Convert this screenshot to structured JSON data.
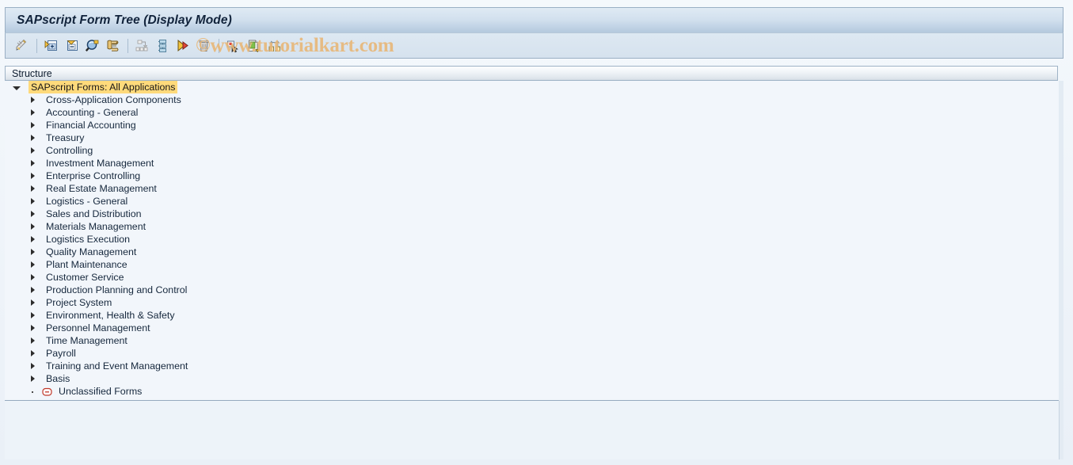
{
  "window": {
    "title": "SAPscript Form Tree (Display Mode)"
  },
  "watermark": {
    "text": "©www.tutorialkart.com",
    "color": "#e8b87a"
  },
  "toolbar": {
    "buttons": [
      {
        "name": "display-change-icon",
        "tooltip": "Display <-> Change"
      },
      {
        "name": "expand-node-icon",
        "tooltip": "Expand Node"
      },
      {
        "name": "collapse-node-icon",
        "tooltip": "Collapse Node"
      },
      {
        "name": "find-icon",
        "tooltip": "Find"
      },
      {
        "name": "scroll-list-icon",
        "tooltip": "Form Overview"
      },
      {
        "name": "sort-structure-icon",
        "tooltip": "Sort"
      },
      {
        "name": "hierarchy-icon",
        "tooltip": "Hierarchy"
      },
      {
        "name": "execute-icon",
        "tooltip": "Execute"
      },
      {
        "name": "delete-icon",
        "tooltip": "Delete"
      },
      {
        "name": "select-object-icon",
        "tooltip": "Select Object"
      },
      {
        "name": "copy-document-icon",
        "tooltip": "Copy"
      },
      {
        "name": "assign-nodes-icon",
        "tooltip": "Assign"
      }
    ]
  },
  "structure": {
    "column_header": "Structure",
    "root": {
      "label": "SAPscript Forms: All Applications",
      "expanded": true,
      "selected": true,
      "highlight_color": "#ffda7b"
    },
    "items": [
      {
        "label": "Cross-Application Components",
        "expanded": false,
        "type": "folder"
      },
      {
        "label": "Accounting - General",
        "expanded": false,
        "type": "folder"
      },
      {
        "label": "Financial Accounting",
        "expanded": false,
        "type": "folder"
      },
      {
        "label": "Treasury",
        "expanded": false,
        "type": "folder"
      },
      {
        "label": "Controlling",
        "expanded": false,
        "type": "folder"
      },
      {
        "label": "Investment Management",
        "expanded": false,
        "type": "folder"
      },
      {
        "label": "Enterprise Controlling",
        "expanded": false,
        "type": "folder"
      },
      {
        "label": "Real Estate Management",
        "expanded": false,
        "type": "folder"
      },
      {
        "label": "Logistics - General",
        "expanded": false,
        "type": "folder"
      },
      {
        "label": "Sales and Distribution",
        "expanded": false,
        "type": "folder"
      },
      {
        "label": "Materials Management",
        "expanded": false,
        "type": "folder"
      },
      {
        "label": "Logistics Execution",
        "expanded": false,
        "type": "folder"
      },
      {
        "label": "Quality Management",
        "expanded": false,
        "type": "folder"
      },
      {
        "label": "Plant Maintenance",
        "expanded": false,
        "type": "folder"
      },
      {
        "label": "Customer Service",
        "expanded": false,
        "type": "folder"
      },
      {
        "label": "Production Planning and Control",
        "expanded": false,
        "type": "folder"
      },
      {
        "label": "Project System",
        "expanded": false,
        "type": "folder"
      },
      {
        "label": "Environment, Health & Safety",
        "expanded": false,
        "type": "folder"
      },
      {
        "label": "Personnel Management",
        "expanded": false,
        "type": "folder"
      },
      {
        "label": "Time Management",
        "expanded": false,
        "type": "folder"
      },
      {
        "label": "Payroll",
        "expanded": false,
        "type": "folder"
      },
      {
        "label": "Training and Event Management",
        "expanded": false,
        "type": "folder"
      },
      {
        "label": "Basis",
        "expanded": false,
        "type": "folder"
      },
      {
        "label": "Unclassified Forms",
        "expanded": false,
        "type": "leaf",
        "icon": "circle-minus-icon"
      }
    ]
  }
}
